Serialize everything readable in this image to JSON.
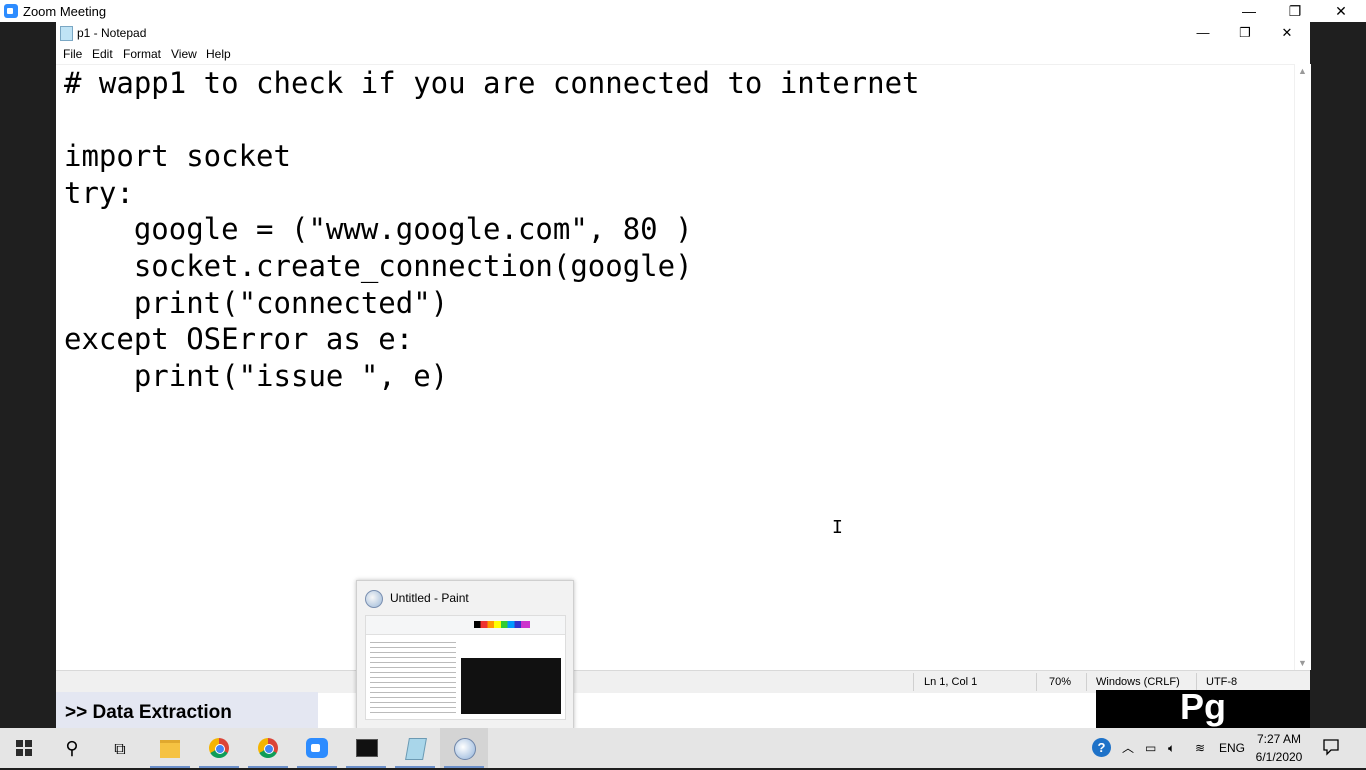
{
  "zoom": {
    "title": "Zoom Meeting",
    "minimize": "—",
    "restore": "❐",
    "close": "✕"
  },
  "notepad": {
    "title": "p1 - Notepad",
    "menu": [
      "File",
      "Edit",
      "Format",
      "View",
      "Help"
    ],
    "code": "# wapp1 to check if you are connected to internet\n\nimport socket\ntry:\n\tgoogle = (\"www.google.com\", 80 )\n\tsocket.create_connection(google)\n\tprint(\"connected\")\nexcept OSError as e:\n\tprint(\"issue \", e)",
    "status": {
      "position": "Ln 1, Col 1",
      "zoom": "70%",
      "line_ending": "Windows (CRLF)",
      "encoding": "UTF-8"
    }
  },
  "overlay": {
    "section_label": ">> Data Extraction",
    "logo_text": "Pg"
  },
  "preview": {
    "title": "Untitled - Paint"
  },
  "taskbar": {
    "language": "ENG",
    "time": "7:27 AM",
    "date": "6/1/2020"
  }
}
